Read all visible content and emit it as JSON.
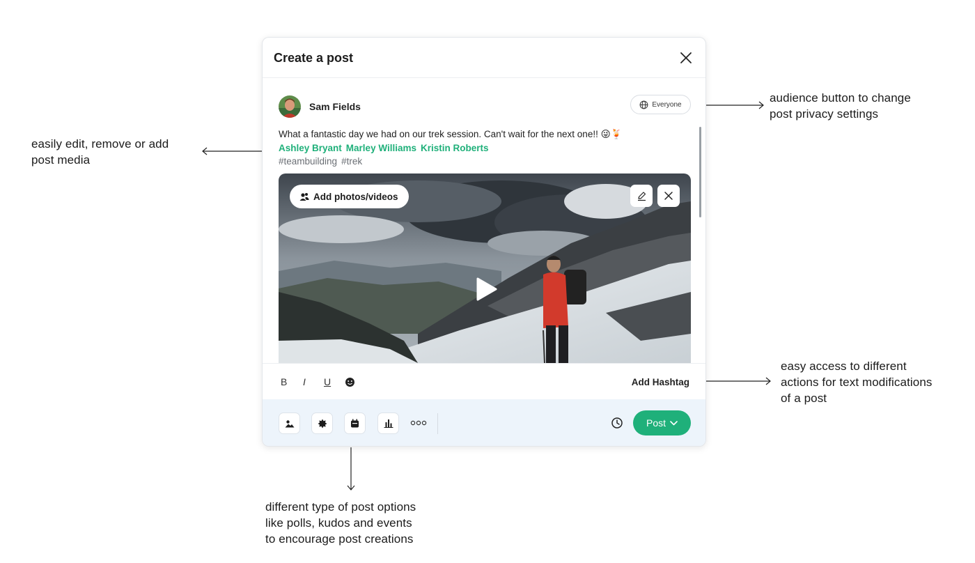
{
  "modal": {
    "title": "Create a post",
    "user_name": "Sam Fields",
    "audience_label": "Everyone",
    "post_text": "What a fantastic day we had on our trek session. Can't wait for the next one!! 😜🍹",
    "tagged_people": [
      "Ashley Bryant",
      "Marley Williams",
      "Kristin Roberts"
    ],
    "hashtags": [
      "#teambuilding",
      "#trek"
    ],
    "add_media_label": "Add photos/videos",
    "format": {
      "bold": "B",
      "italic": "I",
      "underline": "U",
      "add_hashtag": "Add Hashtag"
    },
    "post_button": "Post",
    "post_type_icons": [
      "image-icon",
      "kudos-badge-icon",
      "calendar-icon",
      "poll-chart-icon",
      "more-dots-icon"
    ],
    "accent_color": "#1fb07a"
  },
  "annotations": {
    "media": "easily edit, remove or add\npost media",
    "audience": "audience button to change\npost privacy settings",
    "format": "easy access to different\nactions for text modifications\nof a post",
    "types": "different type of post options\nlike polls, kudos and events\nto encourage post creations"
  }
}
